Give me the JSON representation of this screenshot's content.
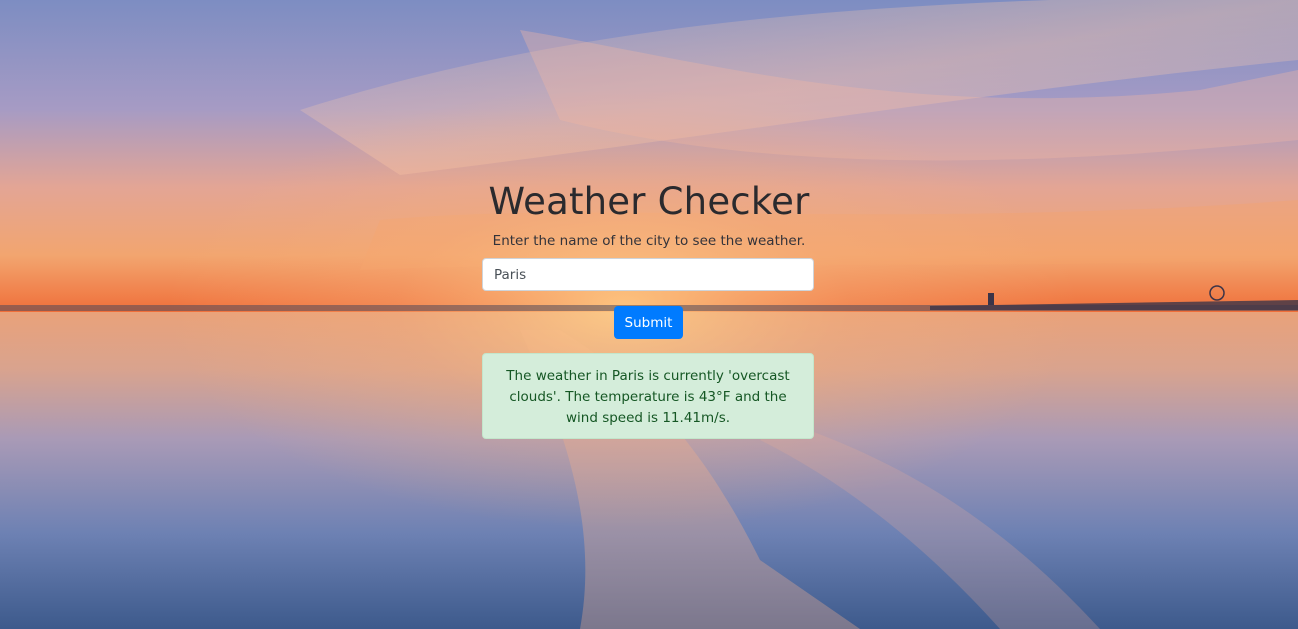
{
  "page": {
    "title": "Weather Checker",
    "subtitle": "Enter the name of the city to see the weather."
  },
  "form": {
    "city_value": "Paris",
    "submit_label": "Submit"
  },
  "result": {
    "message": "The weather in Paris is currently 'overcast clouds'. The temperature is 43°F and the wind speed is 11.41m/s."
  },
  "colors": {
    "button": "#007bff",
    "alert_bg": "#d4edda",
    "alert_text": "#155724"
  }
}
